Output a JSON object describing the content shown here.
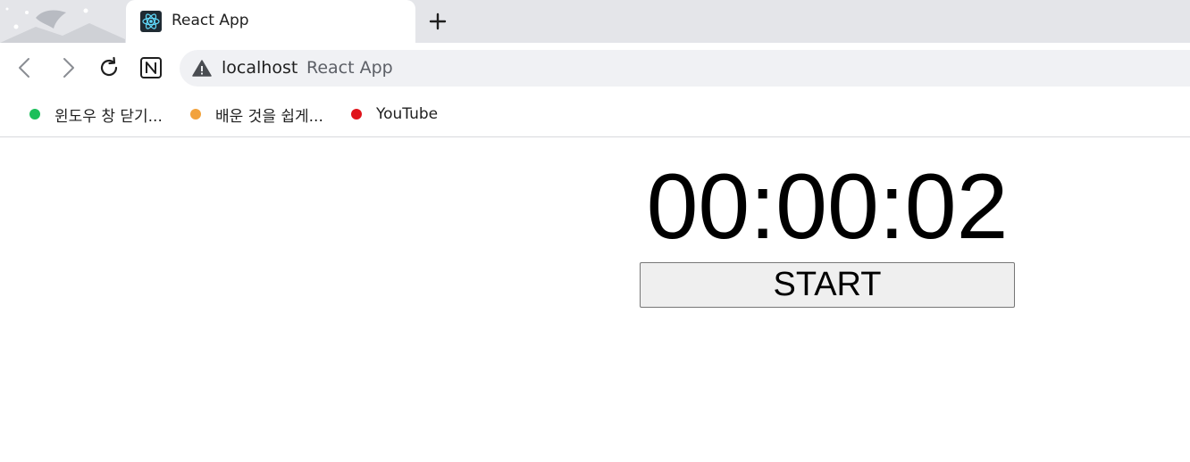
{
  "browser": {
    "tab": {
      "title": "React App",
      "favicon": "react-logo-icon"
    },
    "new_tab_icon": "plus-icon",
    "toolbar": {
      "back_icon": "chevron-left-icon",
      "forward_icon": "chevron-right-icon",
      "reload_icon": "reload-icon",
      "extension_icon": "notion-icon",
      "security_icon": "warning-triangle-icon",
      "url_host": "localhost",
      "url_page_title": "React App"
    },
    "bookmarks": [
      {
        "label": "윈도우 창 닫기...",
        "color": "#1bbf5a"
      },
      {
        "label": "배운 것을 쉽게...",
        "color": "#f2a23c"
      },
      {
        "label": "YouTube",
        "color": "#e0141b"
      }
    ]
  },
  "app": {
    "timer": "00:00:02",
    "start_label": "START"
  }
}
